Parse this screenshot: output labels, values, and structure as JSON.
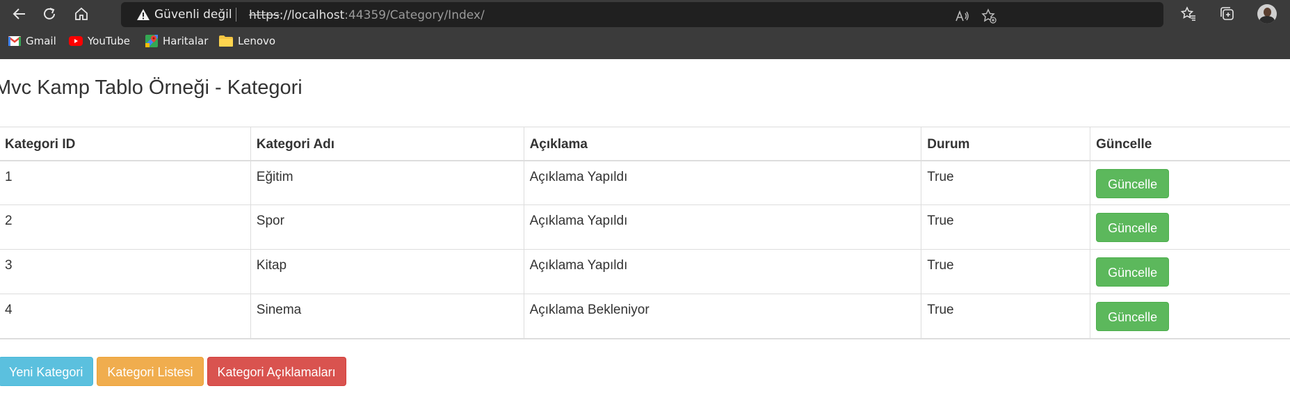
{
  "browser": {
    "address": {
      "security_label": "Güvenli değil",
      "protocol": "https",
      "host": "://localhost",
      "path": ":44359/Category/Index/"
    },
    "bookmarks": [
      {
        "label": "Gmail",
        "icon": "gmail-icon"
      },
      {
        "label": "YouTube",
        "icon": "youtube-icon"
      },
      {
        "label": "Haritalar",
        "icon": "maps-icon"
      },
      {
        "label": "Lenovo",
        "icon": "folder-icon"
      }
    ]
  },
  "page": {
    "title": "Mvc Kamp Tablo Örneği - Kategori"
  },
  "table": {
    "headers": [
      "Kategori ID",
      "Kategori Adı",
      "Açıklama",
      "Durum",
      "Güncelle"
    ],
    "rows": [
      {
        "id": "1",
        "name": "Eğitim",
        "description": "Açıklama Yapıldı",
        "status": "True",
        "action": "Güncelle"
      },
      {
        "id": "2",
        "name": "Spor",
        "description": "Açıklama Yapıldı",
        "status": "True",
        "action": "Güncelle"
      },
      {
        "id": "3",
        "name": "Kitap",
        "description": "Açıklama Yapıldı",
        "status": "True",
        "action": "Güncelle"
      },
      {
        "id": "4",
        "name": "Sinema",
        "description": "Açıklama Bekleniyor",
        "status": "True",
        "action": "Güncelle"
      }
    ]
  },
  "actions": {
    "new_category": "Yeni Kategori",
    "category_list": "Kategori Listesi",
    "category_descriptions": "Kategori Açıklamaları"
  },
  "colors": {
    "success": "#5cb85c",
    "info": "#5bc0de",
    "warning": "#f0ad4e",
    "danger": "#d9534f",
    "chrome": "#3b3b3b"
  }
}
